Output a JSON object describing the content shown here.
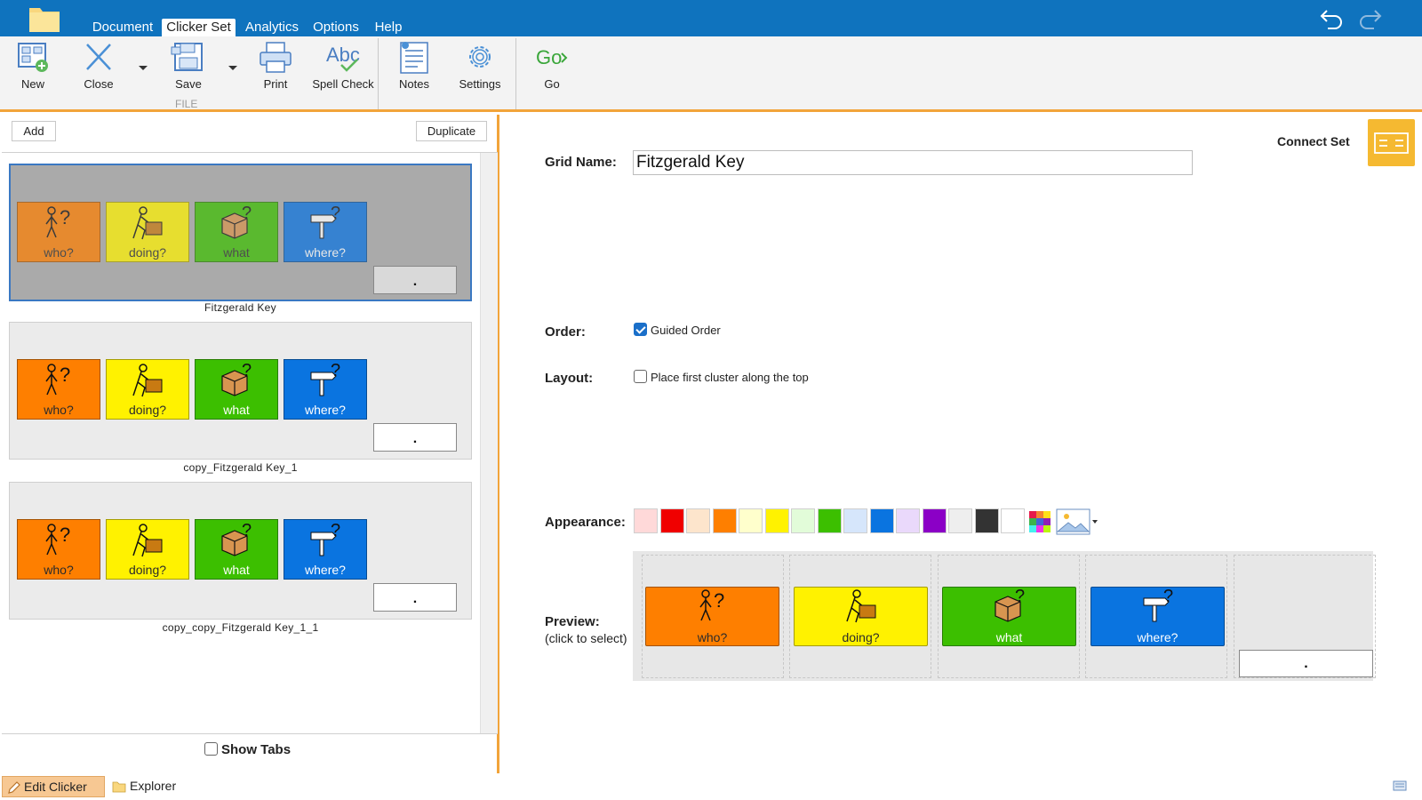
{
  "menu": {
    "tabs": [
      {
        "label": "Document"
      },
      {
        "label": "Clicker Set"
      },
      {
        "label": "Analytics"
      },
      {
        "label": "Options"
      },
      {
        "label": "Help"
      }
    ],
    "active_tab": "Clicker Set"
  },
  "ribbon": {
    "new_label": "New",
    "close_label": "Close",
    "save_label": "Save",
    "file_group_label": "FILE",
    "print_label": "Print",
    "spell_check_label": "Spell Check",
    "notes_label": "Notes",
    "settings_label": "Settings",
    "go_label": "Go"
  },
  "left_panel": {
    "add_label": "Add",
    "duplicate_label": "Duplicate",
    "sets": [
      {
        "name": "Fitzgerald Key",
        "selected": true
      },
      {
        "name": "copy_Fitzgerald Key_1",
        "selected": false
      },
      {
        "name": "copy_copy_Fitzgerald Key_1_1",
        "selected": false
      }
    ],
    "cells": [
      {
        "label": "who?",
        "color": "#fe7f00",
        "icon": "person-question-icon"
      },
      {
        "label": "doing?",
        "color": "#fff200",
        "icon": "person-lifting-box-icon"
      },
      {
        "label": "what",
        "color": "#3cbf00",
        "icon": "box-question-icon"
      },
      {
        "label": "where?",
        "color": "#0a74e0",
        "icon": "signpost-question-icon"
      }
    ],
    "sentence_box_text": ".",
    "show_tabs_label": "Show Tabs"
  },
  "bottom_tabs": {
    "edit_label": "Edit Clicker Set",
    "explorer_label": "Explorer"
  },
  "right_panel": {
    "grid_name_label": "Grid Name:",
    "grid_name_value": "Fitzgerald Key",
    "connect_set_label": "Connect Set",
    "order_label": "Order:",
    "guided_order_label": "Guided Order",
    "guided_order_checked": true,
    "layout_label": "Layout:",
    "layout_option_label": "Place first cluster along the top",
    "layout_option_checked": false,
    "appearance_label": "Appearance:",
    "swatches": [
      "#ffd9d9",
      "#f00000",
      "#fde5cc",
      "#fe7f00",
      "#ffffcc",
      "#fff200",
      "#e2fcd9",
      "#3cbf00",
      "#d6e6fb",
      "#0a74e0",
      "#ead9fb",
      "#8b00c6",
      "#eeeeee",
      "#333333",
      "#ffffff"
    ],
    "preview_label": "Preview:",
    "preview_sublabel": "(click to select)",
    "preview_sentence_text": "."
  }
}
